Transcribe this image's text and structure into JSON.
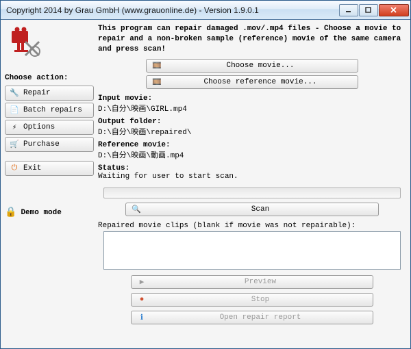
{
  "window": {
    "title": "Copyright 2014 by Grau GmbH (www.grauonline.de) - Version 1.9.0.1"
  },
  "sidebar": {
    "heading": "Choose action:",
    "repair": "Repair",
    "batch": "Batch repairs",
    "options": "Options",
    "purchase": "Purchase",
    "exit": "Exit",
    "demo": "Demo mode"
  },
  "main": {
    "instructions": "This program can repair damaged .mov/.mp4 files - Choose a movie to repair and a non-broken sample (reference) movie of the same camera and press scan!",
    "choose_movie": "Choose movie...",
    "choose_reference": "Choose reference movie...",
    "input_label": "Input movie:",
    "input_value": "D:\\自分\\映画\\GIRL.mp4",
    "output_label": "Output folder:",
    "output_value": "D:\\自分\\映画\\repaired\\",
    "reference_label": "Reference movie:",
    "reference_value": "D:\\自分\\映画\\動画.mp4",
    "status_label": "Status:",
    "status_value": "Waiting for user to start scan.",
    "scan": "Scan",
    "repaired_label": "Repaired movie clips (blank if movie was not repairable):",
    "preview": "Preview",
    "stop": "Stop",
    "open_report": "Open repair report"
  }
}
